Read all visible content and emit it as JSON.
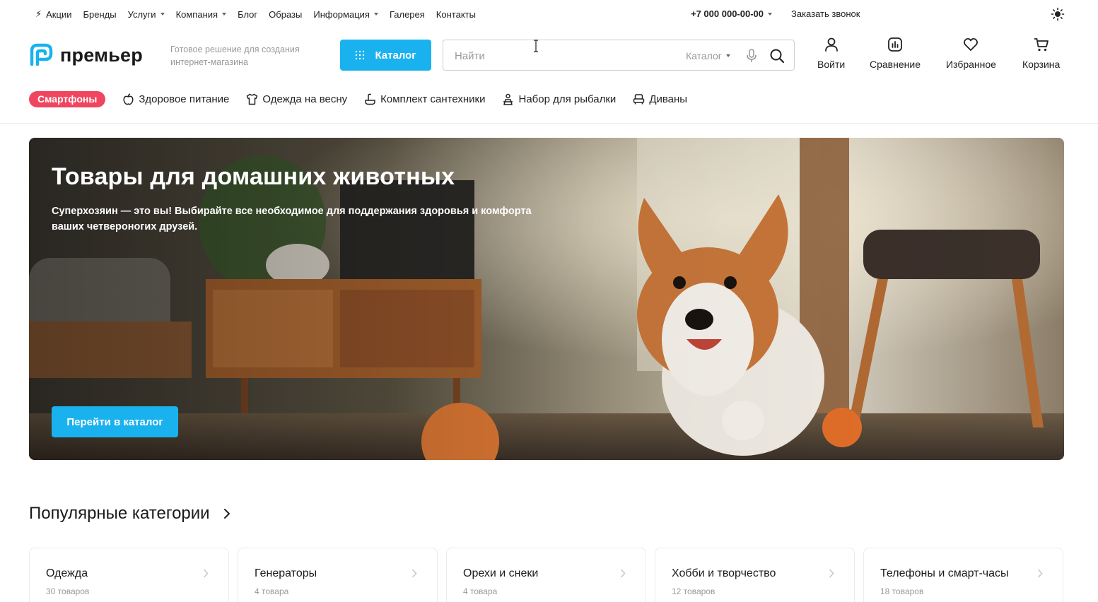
{
  "colors": {
    "accent": "#1ab2ee",
    "badge": "#f0455f",
    "text": "#222222",
    "muted": "#999999"
  },
  "topnav": {
    "items": [
      {
        "label": "Акции",
        "icon": "bolt-icon",
        "dropdown": false
      },
      {
        "label": "Бренды",
        "dropdown": false
      },
      {
        "label": "Услуги",
        "dropdown": true
      },
      {
        "label": "Компания",
        "dropdown": true
      },
      {
        "label": "Блог",
        "dropdown": false
      },
      {
        "label": "Образы",
        "dropdown": false
      },
      {
        "label": "Информация",
        "dropdown": true
      },
      {
        "label": "Галерея",
        "dropdown": false
      },
      {
        "label": "Контакты",
        "dropdown": false
      }
    ],
    "phone": "+7 000 000-00-00",
    "callback": "Заказать звонок",
    "theme_icon": "sun-icon"
  },
  "header": {
    "logo_text": "премьер",
    "tagline": "Готовое решение для создания интернет-магазина",
    "catalog_label": "Каталог",
    "search": {
      "placeholder": "Найти",
      "value": "",
      "scope": "Каталог"
    },
    "actions": [
      {
        "label": "Войти",
        "icon": "user-icon"
      },
      {
        "label": "Сравнение",
        "icon": "compare-chart-icon"
      },
      {
        "label": "Избранное",
        "icon": "heart-icon"
      },
      {
        "label": "Корзина",
        "icon": "cart-icon"
      }
    ]
  },
  "quick_links": {
    "badge": "Смартфоны",
    "items": [
      {
        "label": "Здоровое питание",
        "icon": "apple-icon"
      },
      {
        "label": "Одежда на весну",
        "icon": "tshirt-icon"
      },
      {
        "label": "Комплект сантехники",
        "icon": "faucet-icon"
      },
      {
        "label": "Набор для рыбалки",
        "icon": "fisherman-icon"
      },
      {
        "label": "Диваны",
        "icon": "sofa-icon"
      }
    ]
  },
  "hero": {
    "title": "Товары для домашних животных",
    "text": "Суперхозяин — это вы! Выбирайте все необходимое для поддержания здоровья и комфорта ваших четвероногих друзей.",
    "button": "Перейти в каталог"
  },
  "popular": {
    "title": "Популярные категории",
    "cards": [
      {
        "name": "Одежда",
        "count": "30 товаров"
      },
      {
        "name": "Генераторы",
        "count": "4 товара"
      },
      {
        "name": "Орехи и снеки",
        "count": "4 товара"
      },
      {
        "name": "Хобби и творчество",
        "count": "12 товаров"
      },
      {
        "name": "Телефоны и смарт-часы",
        "count": "18 товаров"
      }
    ]
  }
}
